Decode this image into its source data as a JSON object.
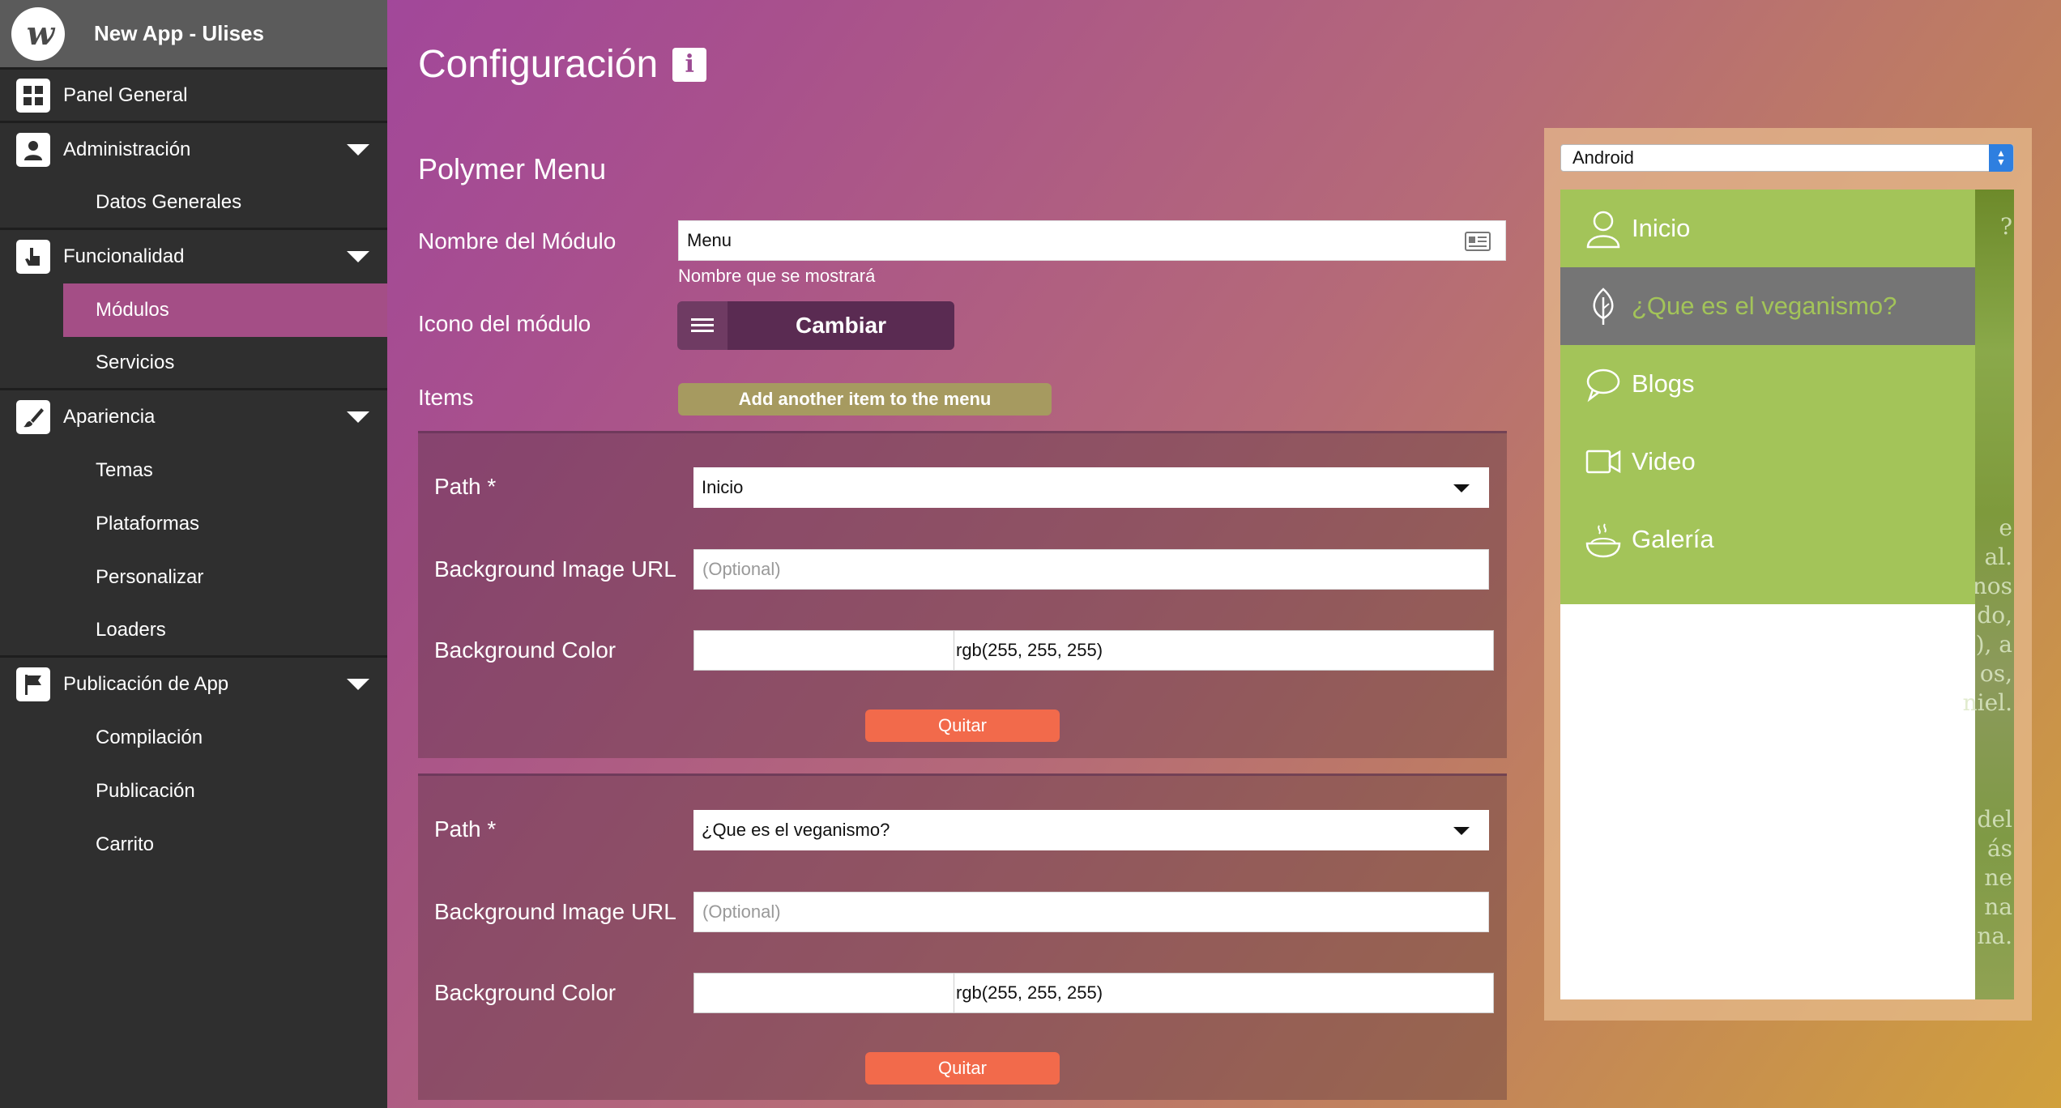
{
  "app": {
    "title": "New App - Ulises"
  },
  "sidebar": {
    "items": [
      {
        "label": "Panel General",
        "icon": "grid-icon"
      },
      {
        "label": "Administración",
        "icon": "user-icon",
        "children": [
          "Datos Generales"
        ]
      },
      {
        "label": "Funcionalidad",
        "icon": "pointer-hand-icon",
        "children": [
          "Módulos",
          "Servicios"
        ],
        "active_child": "Módulos"
      },
      {
        "label": "Apariencia",
        "icon": "brush-icon",
        "children": [
          "Temas",
          "Plataformas",
          "Personalizar",
          "Loaders"
        ]
      },
      {
        "label": "Publicación de App",
        "icon": "flag-icon",
        "children": [
          "Compilación",
          "Publicación",
          "Carrito"
        ]
      }
    ]
  },
  "main": {
    "title": "Configuración",
    "section": "Polymer Menu",
    "module_name": {
      "label": "Nombre del Módulo",
      "value": "Menu",
      "hint": "Nombre que se mostrará"
    },
    "module_icon": {
      "label": "Icono del módulo",
      "button": "Cambiar"
    },
    "items": {
      "label": "Items",
      "add_button": "Add another item to the menu"
    },
    "cards": [
      {
        "path_label": "Path *",
        "path_value": "Inicio",
        "bg_image_label": "Background Image URL",
        "bg_image_placeholder": "(Optional)",
        "bg_color_label": "Background Color",
        "bg_color_value": "rgb(255, 255, 255)",
        "remove": "Quitar"
      },
      {
        "path_label": "Path *",
        "path_value": "¿Que es el veganismo?",
        "bg_image_label": "Background Image URL",
        "bg_image_placeholder": "(Optional)",
        "bg_color_label": "Background Color",
        "bg_color_value": "rgb(255, 255, 255)",
        "remove": "Quitar"
      }
    ]
  },
  "preview": {
    "platform": "Android",
    "menu": [
      {
        "label": "Inicio",
        "icon": "user-outline-icon",
        "active": false
      },
      {
        "label": "¿Que es el veganismo?",
        "icon": "leaf-icon",
        "active": true
      },
      {
        "label": "Blogs",
        "icon": "speech-bubble-icon",
        "active": false
      },
      {
        "label": "Video",
        "icon": "video-camera-icon",
        "active": false
      },
      {
        "label": "Galería",
        "icon": "food-bowl-icon",
        "active": false
      }
    ],
    "colors": {
      "menu_bg": "#a3c459",
      "active_bg": "#757575"
    }
  },
  "colors": {
    "sidebar": "#2f2f2f",
    "sidebar_active": "#a44e86",
    "remove_button": "#f26a4b",
    "add_button": "#a69a60"
  }
}
